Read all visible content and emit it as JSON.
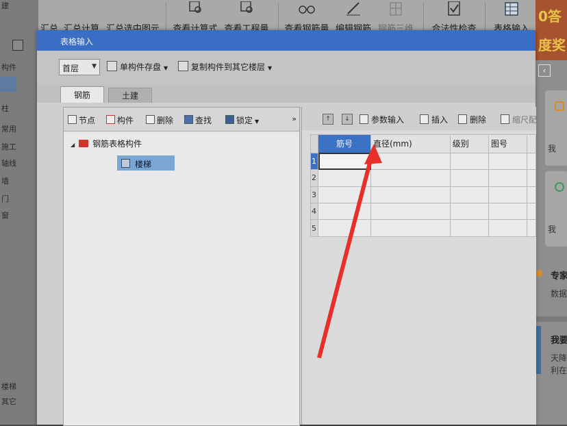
{
  "toolbar": {
    "items": [
      {
        "label": "汇总",
        "icon": "summary-icon"
      },
      {
        "label": "汇总计算",
        "icon": "calc-icon"
      },
      {
        "label": "汇总选中图元",
        "icon": "summary-selected-icon"
      },
      {
        "label": "查看计算式",
        "icon": "view-formula-icon"
      },
      {
        "label": "查看工程量",
        "icon": "view-quantity-icon"
      },
      {
        "label": "查看钢筋量",
        "icon": "glasses-icon"
      },
      {
        "label": "编辑钢筋",
        "icon": "pencil-icon"
      },
      {
        "label": "钢筋三维",
        "icon": "rebar-3d-icon"
      },
      {
        "label": "合法性检查",
        "icon": "check-icon"
      },
      {
        "label": "表格输入",
        "icon": "table-icon"
      }
    ]
  },
  "left_strip": {
    "items": [
      "建",
      "构件",
      "柱",
      "常用",
      "施工",
      "轴线",
      "墙",
      "门",
      "窗",
      "楼梯",
      "其它"
    ]
  },
  "right_strip": {
    "banner_line1": "0答",
    "banner_line2": "度奖",
    "card1_text": "我",
    "card2_text": "我",
    "expert_title": "专家",
    "expert_sub": "数据",
    "want_title": "我要",
    "want_line1": "天降",
    "want_line2": "利在"
  },
  "dialog": {
    "title": "表格输入",
    "floor": "首层",
    "save_component_label": "单构件存盘",
    "copy_component_label": "复制构件到其它楼层",
    "tabs": [
      {
        "label": "钢筋",
        "active": true
      },
      {
        "label": "土建",
        "active": false
      }
    ]
  },
  "tree_toolbar": {
    "node": "节点",
    "component": "构件",
    "delete": "删除",
    "find": "查找",
    "lock": "锁定",
    "more": "»"
  },
  "tree": {
    "root": "钢筋表格构件",
    "child": "楼梯"
  },
  "grid_toolbar": {
    "param_input": "参数输入",
    "insert": "插入",
    "delete": "删除",
    "scale": "缩尺配"
  },
  "grid": {
    "columns": [
      "筋号",
      "直径(mm)",
      "级别",
      "图号"
    ],
    "row_numbers": [
      "1",
      "2",
      "3",
      "4",
      "5"
    ]
  },
  "annotation": {
    "color": "#e8302a"
  }
}
